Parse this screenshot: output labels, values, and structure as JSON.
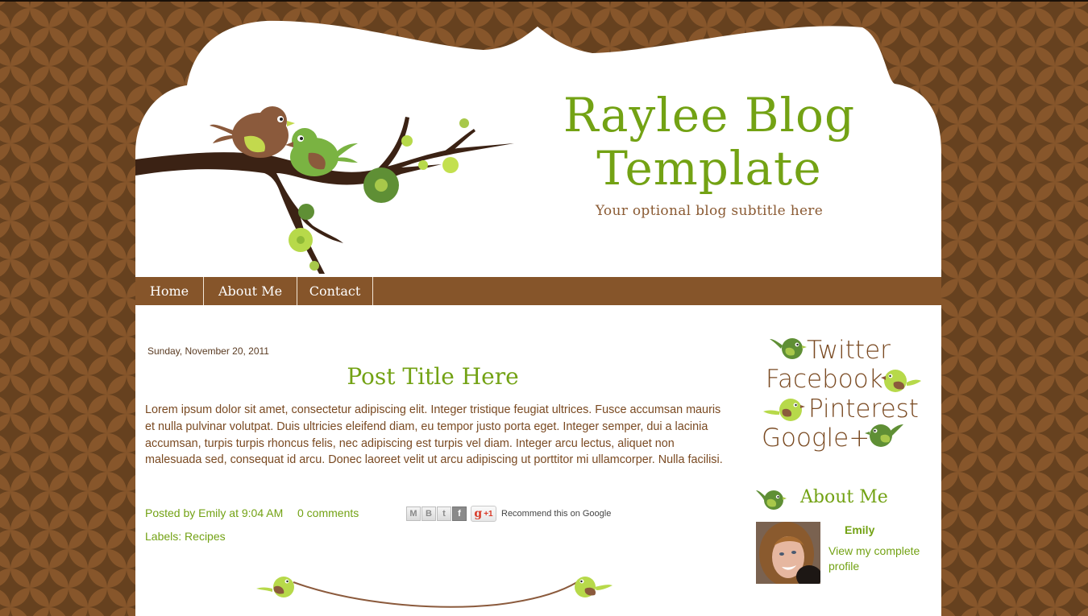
{
  "colors": {
    "background_dark": "#66411f",
    "background_light": "#86552a",
    "accent_green": "#73a214",
    "text_brown": "#7a4a22",
    "nav_brown": "#86552a"
  },
  "header": {
    "title": "Raylee Blog Template",
    "title_line1": "Raylee Blog",
    "title_line2": "Template",
    "subtitle": "Your optional blog subtitle here",
    "art_icon": "branch-with-birds-illustration"
  },
  "nav": {
    "items": [
      {
        "label": "Home"
      },
      {
        "label": "About Me"
      },
      {
        "label": "Contact"
      }
    ]
  },
  "post": {
    "date": "Sunday, November 20, 2011",
    "title": "Post Title Here",
    "body": "Lorem ipsum dolor sit amet, consectetur adipiscing elit. Integer tristique feugiat ultrices. Fusce accumsan mauris et nulla pulvinar volutpat. Duis ultricies eleifend diam, eu tempor justo porta eget. Integer semper, dui a lacinia accumsan, turpis turpis rhoncus felis, nec adipiscing est turpis vel diam. Integer arcu lectus, aliquet non malesuada sed, consequat id arcu. Donec laoreet velit ut arcu adipiscing ut porttitor mi ullamcorper. Nulla facilisi.",
    "posted_by_prefix": "Posted by",
    "author": "Emily",
    "at_label": "at",
    "time": "9:04 AM",
    "comments": "0 comments",
    "share": {
      "buttons": [
        {
          "name": "email",
          "glyph": "M"
        },
        {
          "name": "blogger",
          "glyph": "B"
        },
        {
          "name": "twitter",
          "glyph": "t"
        },
        {
          "name": "facebook",
          "glyph": "f"
        }
      ],
      "plusone_g": "g",
      "plusone_label": "+1",
      "recommend_text": "Recommend this on Google"
    },
    "labels_prefix": "Labels:",
    "labels": [
      "Recipes"
    ],
    "divider_icon": "birds-holding-string-divider"
  },
  "sidebar": {
    "social_links": [
      {
        "label": "Twitter"
      },
      {
        "label": "Facebook"
      },
      {
        "label": "Pinterest"
      },
      {
        "label": "Google+"
      }
    ],
    "about": {
      "title": "About Me",
      "name": "Emily",
      "profile_link": "View my complete profile"
    }
  }
}
